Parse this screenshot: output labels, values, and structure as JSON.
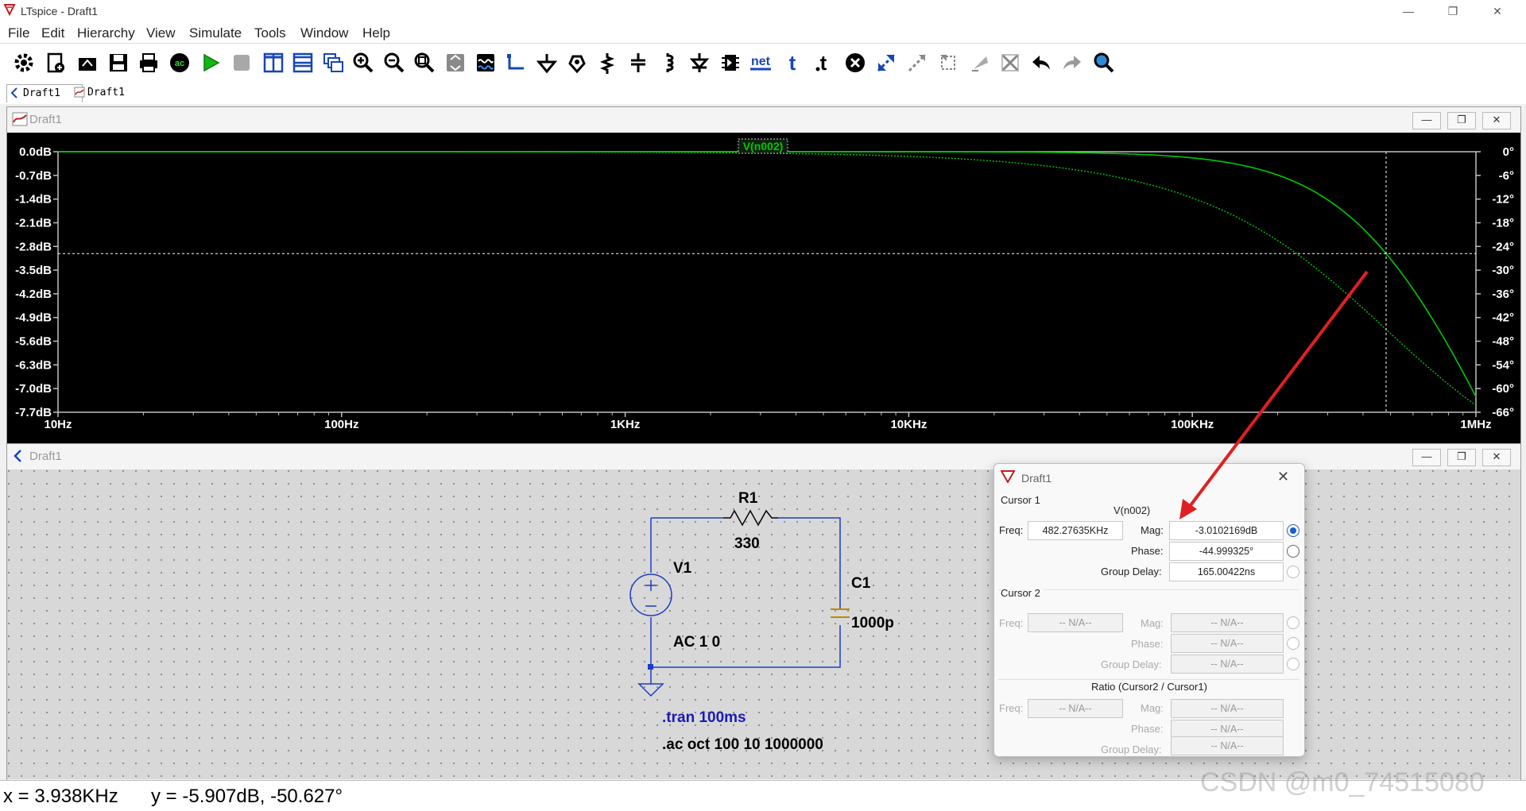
{
  "window": {
    "title": "LTspice - Draft1"
  },
  "menu": [
    "File",
    "Edit",
    "Hierarchy",
    "View",
    "Simulate",
    "Tools",
    "Window",
    "Help"
  ],
  "toolbar": {
    "icons": [
      "settings-icon",
      "new-schematic-icon",
      "open-icon",
      "save-icon",
      "print-icon",
      "ac-analysis-icon",
      "run-icon",
      "halt-icon",
      "tile-vertical-icon",
      "tile-horizontal-icon",
      "cascade-icon",
      "zoom-in-icon",
      "zoom-out-icon",
      "zoom-fit-icon",
      "autorange-icon",
      "waveform-icon",
      "wire-icon",
      "ground-icon",
      "label-net-icon",
      "resistor-icon",
      "capacitor-icon",
      "inductor-icon",
      "diode-icon",
      "component-icon",
      "netname-icon",
      "text-icon",
      "spice-directive-icon",
      "delete-icon",
      "move-icon",
      "drag-icon",
      "rotate-icon",
      "mirror-icon",
      "cross-icon",
      "undo-icon",
      "redo-icon",
      "find-icon"
    ],
    "net_label": "net",
    "t_label": "t",
    "ac_label": "ac"
  },
  "tabs": [
    {
      "label": "Draft1"
    },
    {
      "label": "Draft1"
    }
  ],
  "plot_pane": {
    "title": "Draft1",
    "trace_label": "V(n002)",
    "y_left_ticks": [
      "0.0dB",
      "-0.7dB",
      "-1.4dB",
      "-2.1dB",
      "-2.8dB",
      "-3.5dB",
      "-4.2dB",
      "-4.9dB",
      "-5.6dB",
      "-6.3dB",
      "-7.0dB",
      "-7.7dB"
    ],
    "y_right_ticks": [
      "0°",
      "-6°",
      "-12°",
      "-18°",
      "-24°",
      "-30°",
      "-36°",
      "-42°",
      "-48°",
      "-54°",
      "-60°",
      "-66°"
    ],
    "x_ticks": [
      "10Hz",
      "100Hz",
      "1KHz",
      "10KHz",
      "100KHz",
      "1MHz"
    ],
    "colors": {
      "background": "#000000",
      "trace": "#00c800",
      "axis": "#bfbfbf"
    }
  },
  "schematic_pane": {
    "title": "Draft1",
    "r1_name": "R1",
    "r1_value": "330",
    "v1_name": "V1",
    "v1_value": "AC 1 0",
    "c1_name": "C1",
    "c1_value": "1000p",
    "directive_tran": ".tran 100ms",
    "directive_ac": ".ac oct 100 10 1000000"
  },
  "cursor_dialog": {
    "title": "Draft1",
    "cursor1_label": "Cursor 1",
    "trace_name": "V(n002)",
    "freq_label": "Freq:",
    "freq_value": "482.27635KHz",
    "mag_label": "Mag:",
    "mag_value": "-3.0102169dB",
    "phase_label": "Phase:",
    "phase_value": "-44.999325°",
    "group_delay_label": "Group Delay:",
    "group_delay_value": "165.00422ns",
    "cursor2_label": "Cursor 2",
    "na": "-- N/A--",
    "ratio_label": "Ratio (Cursor2 / Cursor1)"
  },
  "status": {
    "x_readout": "x = 3.938KHz",
    "y_readout": "y = -5.907dB, -50.627°"
  },
  "watermark": "CSDN @m0_74515080"
}
